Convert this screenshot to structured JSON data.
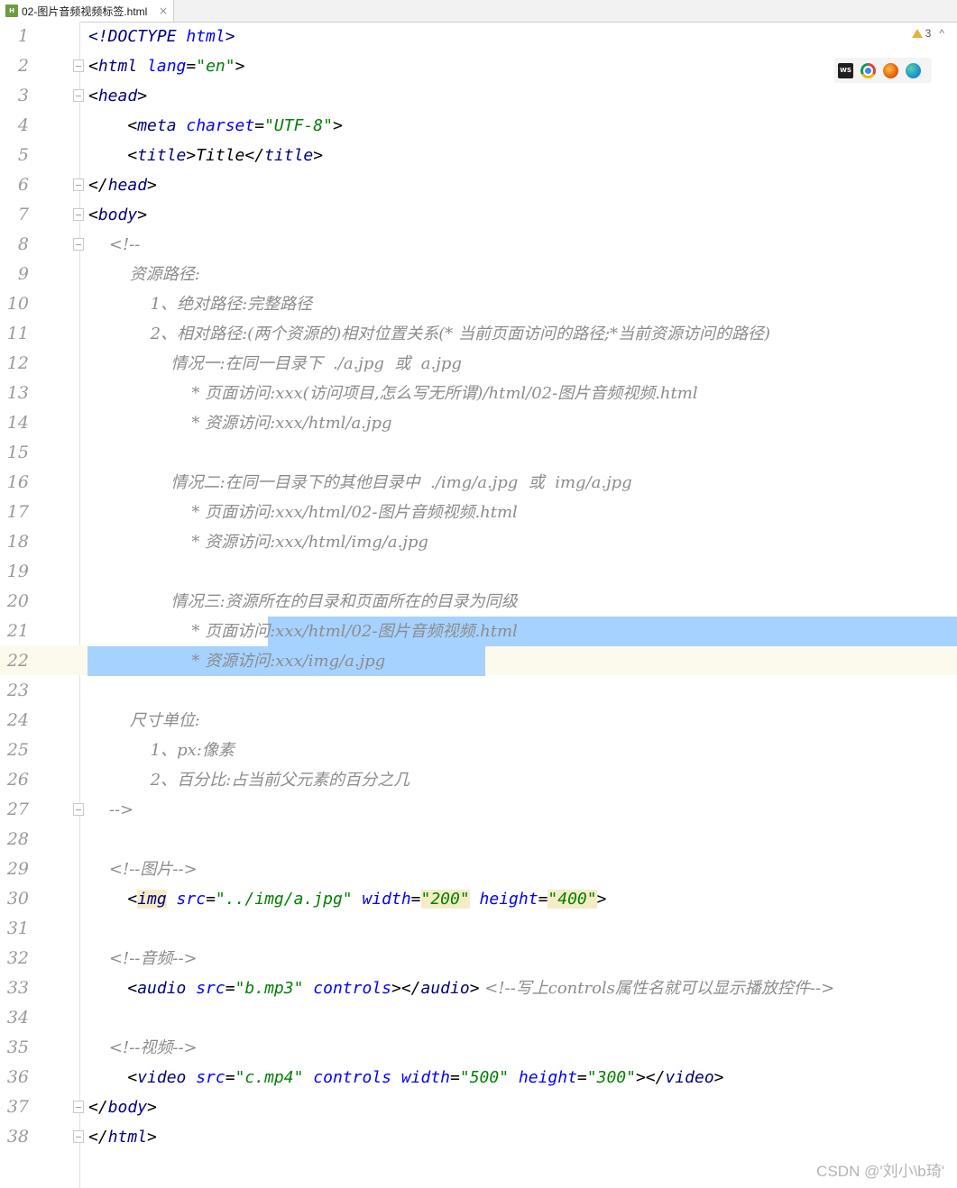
{
  "tab": {
    "title": "02-图片音频视频标签.html",
    "icon": "html-file-icon",
    "close": "×"
  },
  "inspections": {
    "warnings": "3",
    "nav": "^"
  },
  "browser_icons": {
    "webstorm": "WS"
  },
  "lines": [
    {
      "n": "1",
      "tokens": [
        {
          "t": "<!DOCTYPE ",
          "c": "t-tag"
        },
        {
          "t": "html",
          "c": "t-attr"
        },
        {
          "t": ">",
          "c": "t-tag"
        }
      ]
    },
    {
      "n": "2",
      "fold": true,
      "tokens": [
        {
          "t": "<",
          "c": "t-punct"
        },
        {
          "t": "html ",
          "c": "t-tag"
        },
        {
          "t": "lang",
          "c": "t-attr"
        },
        {
          "t": "=",
          "c": "t-punct"
        },
        {
          "t": "\"en\"",
          "c": "t-val"
        },
        {
          "t": ">",
          "c": "t-punct"
        }
      ]
    },
    {
      "n": "3",
      "fold": true,
      "tokens": [
        {
          "t": "<",
          "c": "t-punct"
        },
        {
          "t": "head",
          "c": "t-tag"
        },
        {
          "t": ">",
          "c": "t-punct"
        }
      ]
    },
    {
      "n": "4",
      "tokens": [
        {
          "t": "    <",
          "c": "t-punct"
        },
        {
          "t": "meta ",
          "c": "t-tag"
        },
        {
          "t": "charset",
          "c": "t-attr"
        },
        {
          "t": "=",
          "c": "t-punct"
        },
        {
          "t": "\"UTF-8\"",
          "c": "t-val"
        },
        {
          "t": ">",
          "c": "t-punct"
        }
      ]
    },
    {
      "n": "5",
      "tokens": [
        {
          "t": "    <",
          "c": "t-punct"
        },
        {
          "t": "title",
          "c": "t-tag"
        },
        {
          "t": ">Title</",
          "c": "t-punct"
        },
        {
          "t": "title",
          "c": "t-tag"
        },
        {
          "t": ">",
          "c": "t-punct"
        }
      ]
    },
    {
      "n": "6",
      "fold": true,
      "tokens": [
        {
          "t": "</",
          "c": "t-punct"
        },
        {
          "t": "head",
          "c": "t-tag"
        },
        {
          "t": ">",
          "c": "t-punct"
        }
      ]
    },
    {
      "n": "7",
      "fold": true,
      "tokens": [
        {
          "t": "<",
          "c": "t-punct"
        },
        {
          "t": "body",
          "c": "t-tag"
        },
        {
          "t": ">",
          "c": "t-punct"
        }
      ]
    },
    {
      "n": "8",
      "fold": true,
      "tokens": [
        {
          "t": "    <!--",
          "c": "t-com"
        }
      ]
    },
    {
      "n": "9",
      "tokens": [
        {
          "t": "        资源路径:",
          "c": "t-com"
        }
      ]
    },
    {
      "n": "10",
      "tokens": [
        {
          "t": "            1、绝对路径:完整路径",
          "c": "t-com"
        }
      ]
    },
    {
      "n": "11",
      "tokens": [
        {
          "t": "            2、相对路径:(两个资源的)相对位置关系(* 当前页面访问的路径;*当前资源访问的路径)",
          "c": "t-com"
        }
      ]
    },
    {
      "n": "12",
      "tokens": [
        {
          "t": "                情况一:在同一目录下  ./a.jpg  或  a.jpg",
          "c": "t-com"
        }
      ]
    },
    {
      "n": "13",
      "tokens": [
        {
          "t": "                    * 页面访问:xxx(访问项目,怎么写无所谓)/html/02-图片音频视频.html",
          "c": "t-com"
        }
      ]
    },
    {
      "n": "14",
      "tokens": [
        {
          "t": "                    * 资源访问:xxx/html/a.jpg",
          "c": "t-com"
        }
      ]
    },
    {
      "n": "15",
      "tokens": []
    },
    {
      "n": "16",
      "tokens": [
        {
          "t": "                情况二:在同一目录下的其他目录中  ./img/a.jpg  或  img/a.jpg",
          "c": "t-com"
        }
      ]
    },
    {
      "n": "17",
      "tokens": [
        {
          "t": "                    * 页面访问:xxx/html/02-图片音频视频.html",
          "c": "t-com"
        }
      ]
    },
    {
      "n": "18",
      "tokens": [
        {
          "t": "                    * 资源访问:xxx/html/img/a.jpg",
          "c": "t-com"
        }
      ]
    },
    {
      "n": "19",
      "tokens": []
    },
    {
      "n": "20",
      "tokens": [
        {
          "t": "                情况三:资源所在的目录和页面所在的目录为同级",
          "c": "t-com"
        }
      ]
    },
    {
      "n": "21",
      "tokens": [
        {
          "t": "                    * 页面访问:xxx/html/02-图片音频视频.html",
          "c": "t-com"
        }
      ]
    },
    {
      "n": "22",
      "tokens": [
        {
          "t": "                    * 资源访问:xxx/img/a.jpg",
          "c": "t-com"
        }
      ]
    },
    {
      "n": "23",
      "tokens": []
    },
    {
      "n": "24",
      "tokens": [
        {
          "t": "        尺寸单位:",
          "c": "t-com"
        }
      ]
    },
    {
      "n": "25",
      "tokens": [
        {
          "t": "            1、px:像素",
          "c": "t-com"
        }
      ]
    },
    {
      "n": "26",
      "tokens": [
        {
          "t": "            2、百分比:占当前父元素的百分之几",
          "c": "t-com"
        }
      ]
    },
    {
      "n": "27",
      "fold": true,
      "tokens": [
        {
          "t": "    -->",
          "c": "t-com"
        }
      ]
    },
    {
      "n": "28",
      "tokens": []
    },
    {
      "n": "29",
      "tokens": [
        {
          "t": "    <!--图片-->",
          "c": "t-com"
        }
      ]
    },
    {
      "n": "30",
      "tokens": [
        {
          "t": "    <",
          "c": "t-punct"
        },
        {
          "t": "img",
          "c": "t-tag hl"
        },
        {
          "t": " ",
          "c": "t-punct"
        },
        {
          "t": "src",
          "c": "t-attr"
        },
        {
          "t": "=",
          "c": "t-punct"
        },
        {
          "t": "\"../img/a.jpg\"",
          "c": "t-val"
        },
        {
          "t": " ",
          "c": "t-punct"
        },
        {
          "t": "width",
          "c": "t-attr"
        },
        {
          "t": "=",
          "c": "t-punct"
        },
        {
          "t": "\"200\"",
          "c": "t-val hl"
        },
        {
          "t": " ",
          "c": "t-punct"
        },
        {
          "t": "height",
          "c": "t-attr"
        },
        {
          "t": "=",
          "c": "t-punct"
        },
        {
          "t": "\"400\"",
          "c": "t-val hl"
        },
        {
          "t": ">",
          "c": "t-punct"
        }
      ]
    },
    {
      "n": "31",
      "tokens": []
    },
    {
      "n": "32",
      "tokens": [
        {
          "t": "    <!--音频-->",
          "c": "t-com"
        }
      ]
    },
    {
      "n": "33",
      "tokens": [
        {
          "t": "    <",
          "c": "t-punct"
        },
        {
          "t": "audio ",
          "c": "t-tag"
        },
        {
          "t": "src",
          "c": "t-attr"
        },
        {
          "t": "=",
          "c": "t-punct"
        },
        {
          "t": "\"b.mp3\"",
          "c": "t-val"
        },
        {
          "t": " ",
          "c": "t-punct"
        },
        {
          "t": "controls",
          "c": "t-attr"
        },
        {
          "t": "></",
          "c": "t-punct"
        },
        {
          "t": "audio",
          "c": "t-tag"
        },
        {
          "t": ">",
          "c": "t-punct"
        },
        {
          "t": " <!--写上controls属性名就可以显示播放控件-->",
          "c": "t-com"
        }
      ]
    },
    {
      "n": "34",
      "tokens": []
    },
    {
      "n": "35",
      "tokens": [
        {
          "t": "    <!--视频-->",
          "c": "t-com"
        }
      ]
    },
    {
      "n": "36",
      "tokens": [
        {
          "t": "    <",
          "c": "t-punct"
        },
        {
          "t": "video ",
          "c": "t-tag"
        },
        {
          "t": "src",
          "c": "t-attr"
        },
        {
          "t": "=",
          "c": "t-punct"
        },
        {
          "t": "\"c.mp4\"",
          "c": "t-val"
        },
        {
          "t": " ",
          "c": "t-punct"
        },
        {
          "t": "controls ",
          "c": "t-attr"
        },
        {
          "t": "width",
          "c": "t-attr"
        },
        {
          "t": "=",
          "c": "t-punct"
        },
        {
          "t": "\"500\"",
          "c": "t-val"
        },
        {
          "t": " ",
          "c": "t-punct"
        },
        {
          "t": "height",
          "c": "t-attr"
        },
        {
          "t": "=",
          "c": "t-punct"
        },
        {
          "t": "\"300\"",
          "c": "t-val"
        },
        {
          "t": "></",
          "c": "t-punct"
        },
        {
          "t": "video",
          "c": "t-tag"
        },
        {
          "t": ">",
          "c": "t-punct"
        }
      ]
    },
    {
      "n": "37",
      "fold": true,
      "tokens": [
        {
          "t": "</",
          "c": "t-punct"
        },
        {
          "t": "body",
          "c": "t-tag"
        },
        {
          "t": ">",
          "c": "t-punct"
        }
      ]
    },
    {
      "n": "38",
      "fold": true,
      "tokens": [
        {
          "t": "</",
          "c": "t-punct"
        },
        {
          "t": "html",
          "c": "t-tag"
        },
        {
          "t": ">",
          "c": "t-punct"
        }
      ]
    }
  ],
  "selection": {
    "from_line": "21",
    "to_line": "22",
    "current_line": "22"
  },
  "watermark": "CSDN @'刘小\\b琦'"
}
